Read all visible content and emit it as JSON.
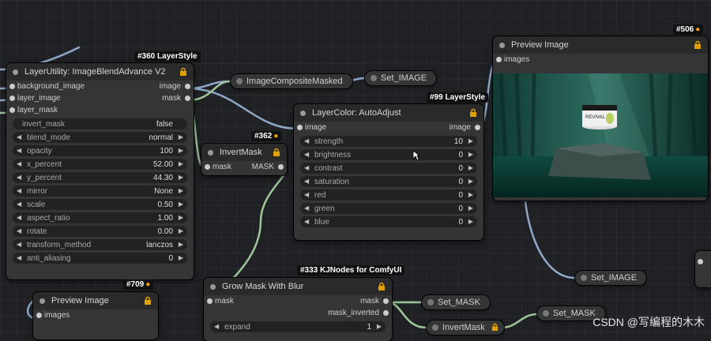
{
  "nodes": {
    "blend": {
      "badge": "#360 LayerStyle",
      "title": "LayerUtility: ImageBlendAdvance V2",
      "inputs": [
        "background_image",
        "layer_image",
        "layer_mask"
      ],
      "outputs": [
        "image",
        "mask"
      ],
      "widgets": [
        {
          "label": "invert_mask",
          "value": "false",
          "toggle": true
        },
        {
          "label": "blend_mode",
          "value": "normal"
        },
        {
          "label": "opacity",
          "value": "100"
        },
        {
          "label": "x_percent",
          "value": "52.00"
        },
        {
          "label": "y_percent",
          "value": "44.30"
        },
        {
          "label": "mirror",
          "value": "None"
        },
        {
          "label": "scale",
          "value": "0.50"
        },
        {
          "label": "aspect_ratio",
          "value": "1.00"
        },
        {
          "label": "rotate",
          "value": "0.00"
        },
        {
          "label": "transform_method",
          "value": "lanczos"
        },
        {
          "label": "anti_aliasing",
          "value": "0"
        }
      ]
    },
    "composite": {
      "title": "ImageCompositeMasked"
    },
    "set_image_top": {
      "title": "Set_IMAGE"
    },
    "invert_mask": {
      "badge": "#362",
      "title": "InvertMask",
      "input": "mask",
      "output": "MASK"
    },
    "auto_adjust": {
      "badge": "#99 LayerStyle",
      "title": "LayerColor: AutoAdjust",
      "input": "image",
      "output": "image",
      "widgets": [
        {
          "label": "strength",
          "value": "10"
        },
        {
          "label": "brightness",
          "value": "0"
        },
        {
          "label": "contrast",
          "value": "0"
        },
        {
          "label": "saturation",
          "value": "0"
        },
        {
          "label": "red",
          "value": "0"
        },
        {
          "label": "green",
          "value": "0"
        },
        {
          "label": "blue",
          "value": "0"
        }
      ]
    },
    "preview_main": {
      "badge": "#506",
      "title": "Preview Image",
      "input": "images",
      "product_brand": "REVIVAL"
    },
    "set_image_bottom": {
      "title": "Set_IMAGE"
    },
    "preview_small": {
      "badge": "#709",
      "title": "Preview Image",
      "input": "images"
    },
    "grow_mask": {
      "badge": "#333 KJNodes for ComfyUI",
      "title": "Grow Mask With Blur",
      "input": "mask",
      "outputs": [
        "mask",
        "mask_inverted"
      ],
      "widgets": [
        {
          "label": "expand",
          "value": "1"
        }
      ]
    },
    "set_mask_1": {
      "title": "Set_MASK"
    },
    "set_mask_2": {
      "title": "Set_MASK"
    },
    "invert_mask_2": {
      "title": "InvertMask"
    }
  },
  "watermark": "CSDN @写编程的木木",
  "colors": {
    "wire_image": "#8fa8c8",
    "wire_mask": "#9ec79a",
    "fox": "#f39c12",
    "lock": "#e0a000"
  }
}
